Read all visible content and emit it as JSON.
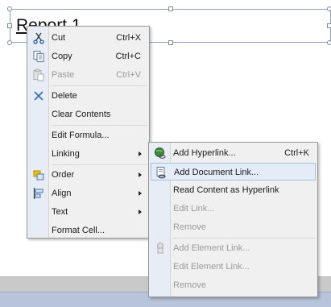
{
  "report": {
    "title": "Report 1"
  },
  "context_menu": {
    "items": [
      {
        "label": "Cut",
        "shortcut": "Ctrl+X",
        "icon": "scissors-icon",
        "enabled": true
      },
      {
        "label": "Copy",
        "shortcut": "Ctrl+C",
        "icon": "copy-icon",
        "enabled": true
      },
      {
        "label": "Paste",
        "shortcut": "Ctrl+V",
        "icon": "paste-icon",
        "enabled": false
      },
      {
        "label": "Delete",
        "icon": "delete-icon",
        "enabled": true
      },
      {
        "label": "Clear Contents",
        "enabled": true
      },
      {
        "label": "Edit Formula...",
        "enabled": true
      },
      {
        "label": "Linking",
        "enabled": true,
        "submenu": true
      },
      {
        "label": "Order",
        "icon": "order-icon",
        "enabled": true,
        "submenu": true
      },
      {
        "label": "Align",
        "icon": "align-icon",
        "enabled": true,
        "submenu": true
      },
      {
        "label": "Text",
        "enabled": true,
        "submenu": true
      },
      {
        "label": "Format Cell...",
        "enabled": true
      }
    ]
  },
  "linking_submenu": {
    "items": [
      {
        "label": "Add Hyperlink...",
        "shortcut": "Ctrl+K",
        "icon": "globe-link-icon",
        "enabled": true
      },
      {
        "label": "Add Document Link...",
        "icon": "document-link-icon",
        "enabled": true,
        "highlighted": true
      },
      {
        "label": "Read Content as Hyperlink",
        "enabled": true
      },
      {
        "label": "Edit Link...",
        "enabled": false
      },
      {
        "label": "Remove",
        "enabled": false
      },
      {
        "label": "Add Element Link...",
        "icon": "element-link-icon",
        "enabled": false
      },
      {
        "label": "Edit Element Link...",
        "enabled": false
      },
      {
        "label": "Remove",
        "enabled": false
      }
    ]
  },
  "colors": {
    "highlight_bg": "#e4ecf7",
    "highlight_border": "#a8c0dd",
    "menu_bg": "#f0f0f0",
    "gutter_bg": "#e8edf5"
  }
}
